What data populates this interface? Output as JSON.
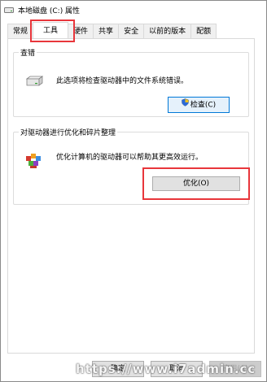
{
  "window": {
    "title": "本地磁盘 (C:) 属性"
  },
  "tabs": [
    {
      "label": "常规"
    },
    {
      "label": "工具"
    },
    {
      "label": "硬件"
    },
    {
      "label": "共享"
    },
    {
      "label": "安全"
    },
    {
      "label": "以前的版本"
    },
    {
      "label": "配额"
    }
  ],
  "active_tab": "工具",
  "check_group": {
    "title": "查错",
    "description": "此选项将检查驱动器中的文件系统错误。",
    "button_label": "检查(C)",
    "icon": "drive-icon"
  },
  "optimize_group": {
    "title": "对驱动器进行优化和碎片整理",
    "description": "优化计算机的驱动器可以帮助其更高效运行。",
    "button_label": "优化(O)",
    "icon": "defrag-icon"
  },
  "footer": {
    "ok_label": "确定",
    "cancel_label": "取消",
    "apply_label": "应用(A)"
  },
  "watermark": "https://www.i7admin.cc",
  "colors": {
    "highlight": "#e8363b",
    "focus_border": "#0078d7"
  }
}
